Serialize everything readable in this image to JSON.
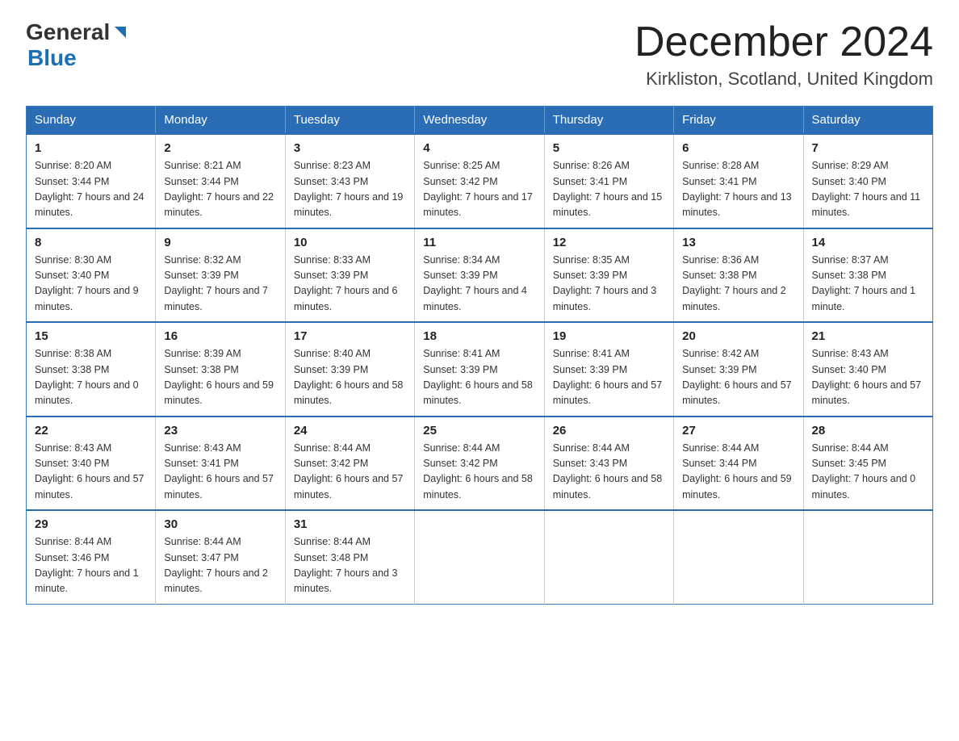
{
  "header": {
    "logo_general": "General",
    "logo_blue": "Blue",
    "month_title": "December 2024",
    "location": "Kirkliston, Scotland, United Kingdom"
  },
  "weekdays": [
    "Sunday",
    "Monday",
    "Tuesday",
    "Wednesday",
    "Thursday",
    "Friday",
    "Saturday"
  ],
  "weeks": [
    [
      {
        "day": "1",
        "sunrise": "8:20 AM",
        "sunset": "3:44 PM",
        "daylight": "7 hours and 24 minutes."
      },
      {
        "day": "2",
        "sunrise": "8:21 AM",
        "sunset": "3:44 PM",
        "daylight": "7 hours and 22 minutes."
      },
      {
        "day": "3",
        "sunrise": "8:23 AM",
        "sunset": "3:43 PM",
        "daylight": "7 hours and 19 minutes."
      },
      {
        "day": "4",
        "sunrise": "8:25 AM",
        "sunset": "3:42 PM",
        "daylight": "7 hours and 17 minutes."
      },
      {
        "day": "5",
        "sunrise": "8:26 AM",
        "sunset": "3:41 PM",
        "daylight": "7 hours and 15 minutes."
      },
      {
        "day": "6",
        "sunrise": "8:28 AM",
        "sunset": "3:41 PM",
        "daylight": "7 hours and 13 minutes."
      },
      {
        "day": "7",
        "sunrise": "8:29 AM",
        "sunset": "3:40 PM",
        "daylight": "7 hours and 11 minutes."
      }
    ],
    [
      {
        "day": "8",
        "sunrise": "8:30 AM",
        "sunset": "3:40 PM",
        "daylight": "7 hours and 9 minutes."
      },
      {
        "day": "9",
        "sunrise": "8:32 AM",
        "sunset": "3:39 PM",
        "daylight": "7 hours and 7 minutes."
      },
      {
        "day": "10",
        "sunrise": "8:33 AM",
        "sunset": "3:39 PM",
        "daylight": "7 hours and 6 minutes."
      },
      {
        "day": "11",
        "sunrise": "8:34 AM",
        "sunset": "3:39 PM",
        "daylight": "7 hours and 4 minutes."
      },
      {
        "day": "12",
        "sunrise": "8:35 AM",
        "sunset": "3:39 PM",
        "daylight": "7 hours and 3 minutes."
      },
      {
        "day": "13",
        "sunrise": "8:36 AM",
        "sunset": "3:38 PM",
        "daylight": "7 hours and 2 minutes."
      },
      {
        "day": "14",
        "sunrise": "8:37 AM",
        "sunset": "3:38 PM",
        "daylight": "7 hours and 1 minute."
      }
    ],
    [
      {
        "day": "15",
        "sunrise": "8:38 AM",
        "sunset": "3:38 PM",
        "daylight": "7 hours and 0 minutes."
      },
      {
        "day": "16",
        "sunrise": "8:39 AM",
        "sunset": "3:38 PM",
        "daylight": "6 hours and 59 minutes."
      },
      {
        "day": "17",
        "sunrise": "8:40 AM",
        "sunset": "3:39 PM",
        "daylight": "6 hours and 58 minutes."
      },
      {
        "day": "18",
        "sunrise": "8:41 AM",
        "sunset": "3:39 PM",
        "daylight": "6 hours and 58 minutes."
      },
      {
        "day": "19",
        "sunrise": "8:41 AM",
        "sunset": "3:39 PM",
        "daylight": "6 hours and 57 minutes."
      },
      {
        "day": "20",
        "sunrise": "8:42 AM",
        "sunset": "3:39 PM",
        "daylight": "6 hours and 57 minutes."
      },
      {
        "day": "21",
        "sunrise": "8:43 AM",
        "sunset": "3:40 PM",
        "daylight": "6 hours and 57 minutes."
      }
    ],
    [
      {
        "day": "22",
        "sunrise": "8:43 AM",
        "sunset": "3:40 PM",
        "daylight": "6 hours and 57 minutes."
      },
      {
        "day": "23",
        "sunrise": "8:43 AM",
        "sunset": "3:41 PM",
        "daylight": "6 hours and 57 minutes."
      },
      {
        "day": "24",
        "sunrise": "8:44 AM",
        "sunset": "3:42 PM",
        "daylight": "6 hours and 57 minutes."
      },
      {
        "day": "25",
        "sunrise": "8:44 AM",
        "sunset": "3:42 PM",
        "daylight": "6 hours and 58 minutes."
      },
      {
        "day": "26",
        "sunrise": "8:44 AM",
        "sunset": "3:43 PM",
        "daylight": "6 hours and 58 minutes."
      },
      {
        "day": "27",
        "sunrise": "8:44 AM",
        "sunset": "3:44 PM",
        "daylight": "6 hours and 59 minutes."
      },
      {
        "day": "28",
        "sunrise": "8:44 AM",
        "sunset": "3:45 PM",
        "daylight": "7 hours and 0 minutes."
      }
    ],
    [
      {
        "day": "29",
        "sunrise": "8:44 AM",
        "sunset": "3:46 PM",
        "daylight": "7 hours and 1 minute."
      },
      {
        "day": "30",
        "sunrise": "8:44 AM",
        "sunset": "3:47 PM",
        "daylight": "7 hours and 2 minutes."
      },
      {
        "day": "31",
        "sunrise": "8:44 AM",
        "sunset": "3:48 PM",
        "daylight": "7 hours and 3 minutes."
      },
      null,
      null,
      null,
      null
    ]
  ]
}
